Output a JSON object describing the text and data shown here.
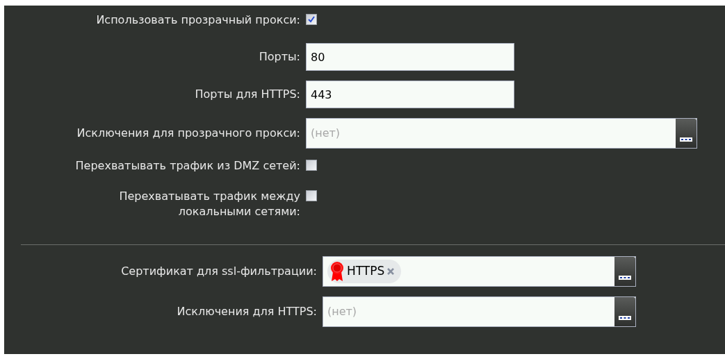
{
  "sections": [
    {
      "rows": [
        {
          "kind": "checkbox",
          "label": "Использовать прозрачный прокси:",
          "checked": true
        },
        {
          "kind": "text",
          "label": "Порты:",
          "value": "80"
        },
        {
          "kind": "text",
          "label": "Порты для HTTPS:",
          "value": "443"
        },
        {
          "kind": "picker",
          "label": "Исключения для прозрачного прокси:",
          "placeholder": "(нет)"
        },
        {
          "kind": "checkbox",
          "label": "Перехватывать трафик из DMZ сетей:",
          "checked": false
        },
        {
          "kind": "checkbox",
          "label": "Перехватывать трафик между локальными сетями:",
          "checked": false
        }
      ]
    },
    {
      "rows": [
        {
          "kind": "picker",
          "label": "Сертификат для ssl-фильтрации:",
          "tags": [
            "HTTPS"
          ]
        },
        {
          "kind": "picker",
          "label": "Исключения для HTTPS:",
          "placeholder": "(нет)"
        }
      ]
    }
  ]
}
